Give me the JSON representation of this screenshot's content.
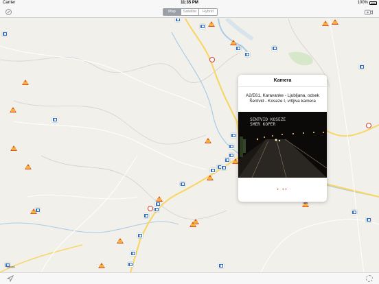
{
  "status_bar": {
    "carrier": "Carrier",
    "time": "11:35 PM",
    "battery": "100%"
  },
  "nav": {
    "segments": [
      {
        "label": "Map",
        "active": true
      },
      {
        "label": "Satellite",
        "active": false
      },
      {
        "label": "Hybrid",
        "active": false
      }
    ]
  },
  "popover": {
    "title": "Kamera",
    "description": "A2/E61, Karavanke - Ljubljana, odsek Šentvid - Koseze I, vrtljiva kamera",
    "overlay_line1": "SENTVID KOSEZE",
    "overlay_line2": "SMER KOPER",
    "pager": "• ••"
  },
  "map": {
    "corner_label": "Jesol"
  },
  "colors": {
    "camera_marker": "#2f6fc6",
    "warning_marker": "#e0502a",
    "circle_marker": "#d83a2a",
    "road": "#f7d66a",
    "water": "#a8cbe8"
  },
  "icons": [
    "compass-icon",
    "camera-list-icon",
    "location-arrow-icon",
    "gear-icon"
  ]
}
